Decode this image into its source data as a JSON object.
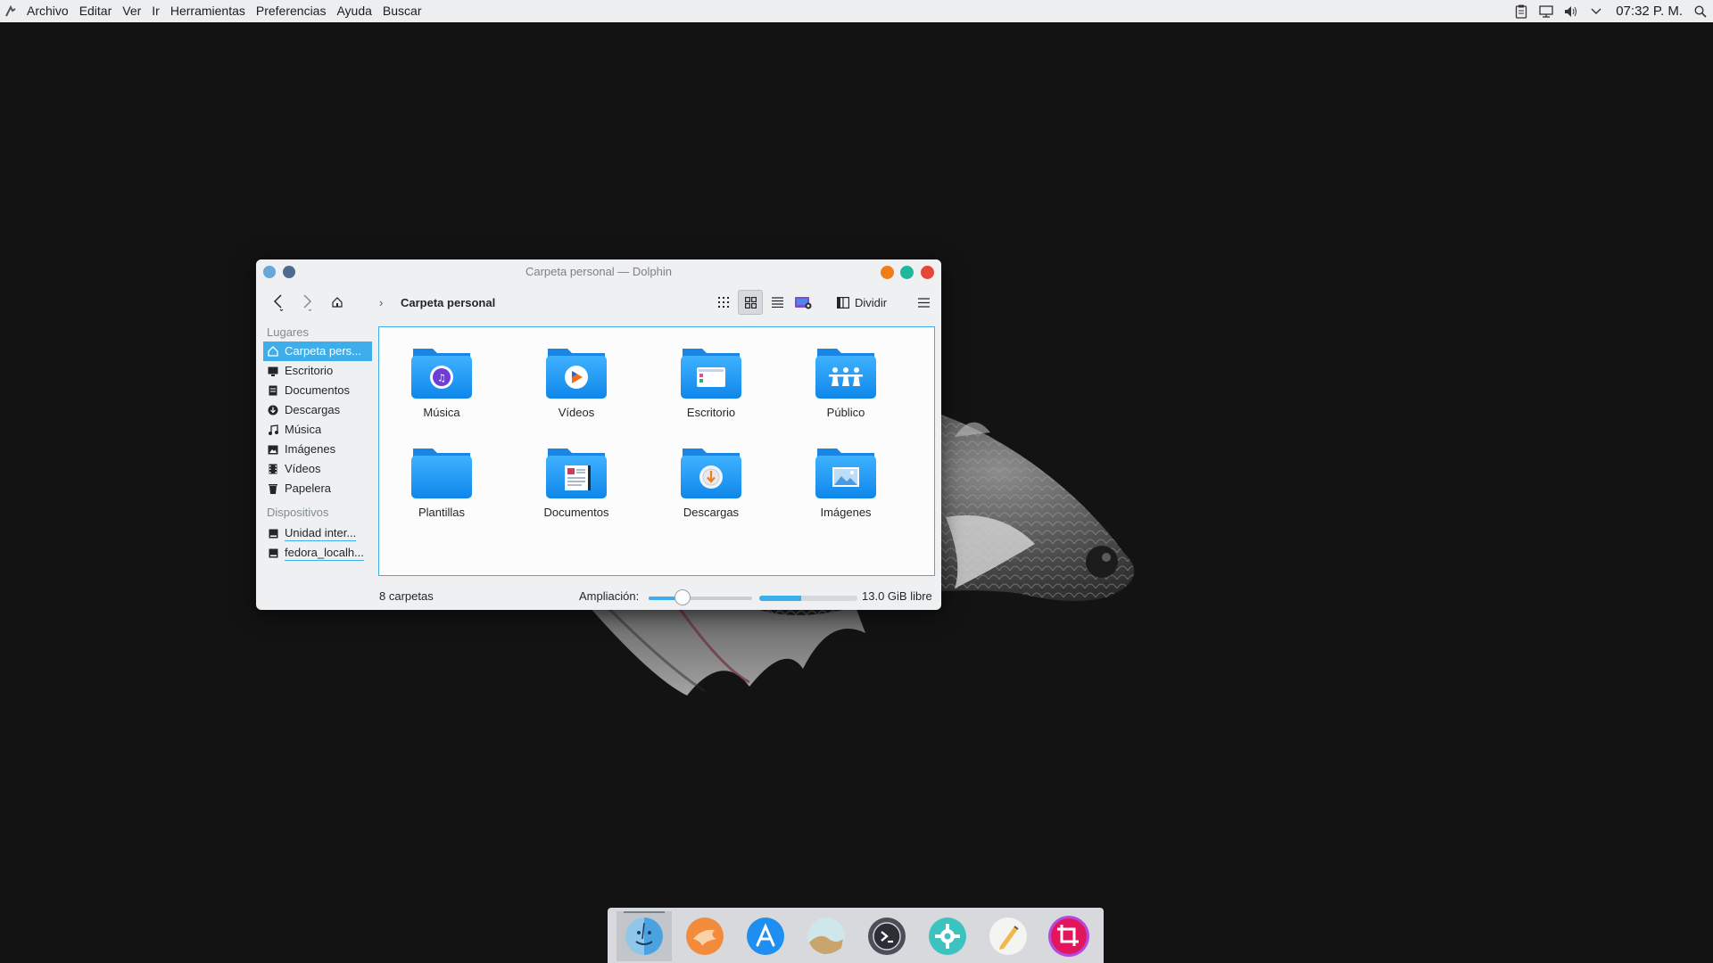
{
  "topbar": {
    "menus": [
      "Archivo",
      "Editar",
      "Ver",
      "Ir",
      "Herramientas",
      "Preferencias",
      "Ayuda",
      "Buscar"
    ],
    "clock": "07:32 P. M.",
    "tray_icons": [
      "clipboard-icon",
      "network-icon",
      "volume-icon",
      "expand-tray-icon",
      "search-icon"
    ]
  },
  "window": {
    "title": "Carpeta personal — Dolphin",
    "toolbar": {
      "breadcrumb": "Carpeta personal",
      "split_label": "Dividir",
      "view_modes": [
        "icons",
        "compact",
        "details"
      ],
      "active_view": "icons"
    },
    "sidebar": {
      "places_header": "Lugares",
      "places": [
        {
          "label": "Carpeta pers...",
          "icon": "home-icon",
          "selected": true
        },
        {
          "label": "Escritorio",
          "icon": "desktop-icon"
        },
        {
          "label": "Documentos",
          "icon": "documents-icon"
        },
        {
          "label": "Descargas",
          "icon": "download-icon"
        },
        {
          "label": "Música",
          "icon": "music-icon"
        },
        {
          "label": "Imágenes",
          "icon": "image-icon"
        },
        {
          "label": "Vídeos",
          "icon": "video-icon"
        },
        {
          "label": "Papelera",
          "icon": "trash-icon"
        }
      ],
      "devices_header": "Dispositivos",
      "devices": [
        {
          "label": "Unidad inter...",
          "icon": "drive-icon"
        },
        {
          "label": "fedora_localh...",
          "icon": "drive-icon"
        }
      ]
    },
    "folders": [
      {
        "name": "Música",
        "emblem": "music-icon"
      },
      {
        "name": "Vídeos",
        "emblem": "play-icon"
      },
      {
        "name": "Escritorio",
        "emblem": "desktop-icon"
      },
      {
        "name": "Público",
        "emblem": "people-icon"
      },
      {
        "name": "Plantillas",
        "emblem": "none"
      },
      {
        "name": "Documentos",
        "emblem": "document-icon"
      },
      {
        "name": "Descargas",
        "emblem": "download-icon"
      },
      {
        "name": "Imágenes",
        "emblem": "image-icon"
      }
    ],
    "status": {
      "count": "8 carpetas",
      "zoom_label": "Ampliación:",
      "zoom_level": 0.33,
      "free_space": "13.0 GiB libre",
      "space_used_fraction": 0.43
    }
  },
  "dock": {
    "apps": [
      "finder-icon",
      "scratch-icon",
      "app-store-icon",
      "wallpaper-icon",
      "terminal-icon",
      "settings-icon",
      "notes-icon",
      "screenshot-icon"
    ],
    "active_index": 0
  },
  "colors": {
    "accent": "#3daee9",
    "folder_blue": "#1f9bf2",
    "close": "#e6453a",
    "maximize": "#20b89a",
    "minimize": "#f07c1a"
  }
}
